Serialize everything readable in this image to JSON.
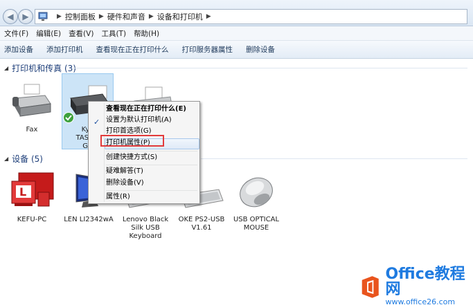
{
  "address": {
    "crumbs": [
      "控制面板",
      "硬件和声音",
      "设备和打印机"
    ]
  },
  "menubar": {
    "items": [
      "文件(F)",
      "编辑(E)",
      "查看(V)",
      "工具(T)",
      "帮助(H)"
    ]
  },
  "cmdbar": {
    "items": [
      "添加设备",
      "添加打印机",
      "查看现在正在打印什么",
      "打印服务器属性",
      "删除设备"
    ]
  },
  "groups": {
    "printers": "打印机和传真 (3)",
    "devices": "设备 (5)"
  },
  "printers": [
    {
      "label": "Fax"
    },
    {
      "label1": "Kyo",
      "label2": "TASKal",
      "label3": "GX"
    }
  ],
  "devices": [
    {
      "label1": "KEFU-PC"
    },
    {
      "label1": "LEN LI2342wA"
    },
    {
      "label1": "Lenovo Black",
      "label2": "Silk USB",
      "label3": "Keyboard"
    },
    {
      "label1": "OKE PS2-USB",
      "label2": "V1.61"
    },
    {
      "label1": "USB OPTICAL",
      "label2": "MOUSE"
    }
  ],
  "context_menu": {
    "items": [
      "查看现在正在打印什么(E)",
      "设置为默认打印机(A)",
      "打印首选项(G)",
      "打印机属性(P)",
      "创建快捷方式(S)",
      "疑难解答(T)",
      "删除设备(V)",
      "属性(R)"
    ],
    "checked_index": 1,
    "highlighted_index": 3
  },
  "watermark": {
    "brand": "Office教程网",
    "url": "www.office26.com"
  },
  "colors": {
    "accent": "#1e3f7a",
    "highlight_box": "#e23b3b",
    "watermark": "#1f7be0"
  }
}
